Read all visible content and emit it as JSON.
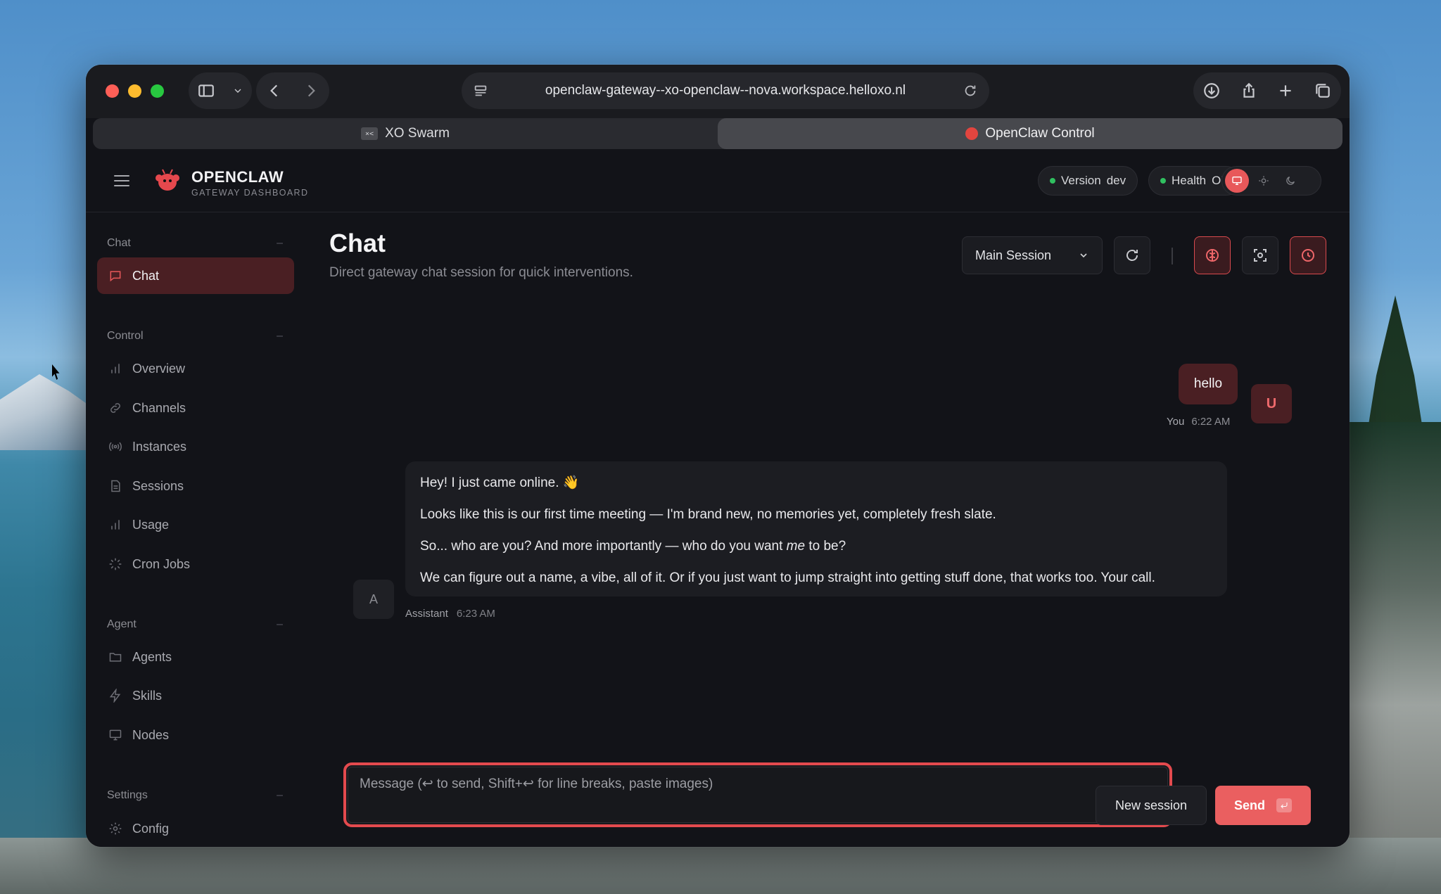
{
  "browser": {
    "url": "openclaw-gateway--xo-openclaw--nova.workspace.helloxo.nl",
    "tabs": [
      {
        "label": "XO Swarm",
        "favicon": "xo-icon"
      },
      {
        "label": "OpenClaw Control",
        "favicon": "openclaw-icon"
      }
    ]
  },
  "header": {
    "brand_name": "OPENCLAW",
    "brand_sub": "GATEWAY DASHBOARD",
    "version_label": "Version",
    "version_value": "dev",
    "health_label": "Health",
    "health_value": "OK"
  },
  "sidebar": {
    "groups": {
      "chat": "Chat",
      "control": "Control",
      "agent": "Agent",
      "settings": "Settings"
    },
    "items": [
      {
        "label": "Chat",
        "icon": "message-icon"
      },
      {
        "label": "Overview",
        "icon": "bar-chart-icon"
      },
      {
        "label": "Channels",
        "icon": "link-icon"
      },
      {
        "label": "Instances",
        "icon": "broadcast-icon"
      },
      {
        "label": "Sessions",
        "icon": "file-icon"
      },
      {
        "label": "Usage",
        "icon": "bar-chart-icon"
      },
      {
        "label": "Cron Jobs",
        "icon": "loader-icon"
      },
      {
        "label": "Agents",
        "icon": "folder-icon"
      },
      {
        "label": "Skills",
        "icon": "bolt-icon"
      },
      {
        "label": "Nodes",
        "icon": "monitor-icon"
      },
      {
        "label": "Config",
        "icon": "gear-icon"
      }
    ]
  },
  "main": {
    "title": "Chat",
    "subtitle": "Direct gateway chat session for quick interventions.",
    "session_select": "Main Session"
  },
  "messages": {
    "user": {
      "text": "hello",
      "avatar": "U",
      "who": "You",
      "time": "6:22 AM"
    },
    "assistant": {
      "p1": "Hey! I just came online. 👋",
      "p2": "Looks like this is our first time meeting — I'm brand new, no memories yet, completely fresh slate.",
      "p3a": "So... who are you? And more importantly — who do you want",
      "p3em": "me",
      "p3b": "to be?",
      "p4": "We can figure out a name, a vibe, all of it. Or if you just want to jump straight into getting stuff done, that works too. Your call.",
      "avatar": "A",
      "who": "Assistant",
      "time": "6:23 AM"
    }
  },
  "composer": {
    "placeholder": "Message (↩ to send, Shift+↩ for line breaks, paste images)",
    "new_session": "New session",
    "send": "Send"
  },
  "colors": {
    "accent": "#ea5f60",
    "active_bg": "#4a1f23",
    "status_ok": "#30c060"
  }
}
